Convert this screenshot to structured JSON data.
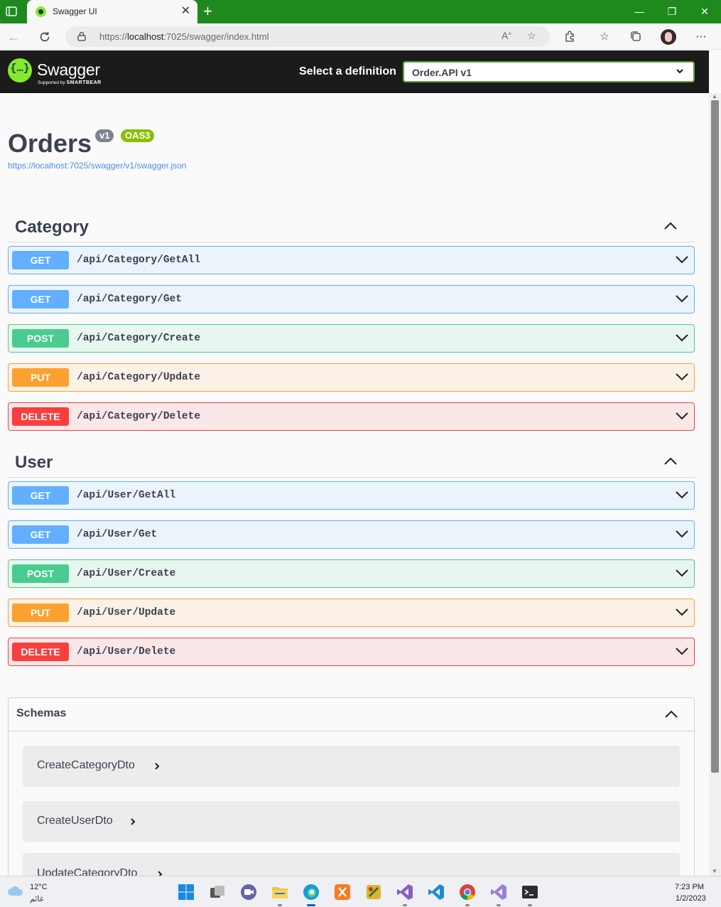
{
  "browser": {
    "tab_title": "Swagger UI",
    "tab_close": "✕",
    "new_tab": "+",
    "url_scheme": "https://",
    "url_host": "localhost",
    "url_rest": ":7025/swagger/index.html",
    "window_controls": [
      "—",
      "❐",
      "✕"
    ]
  },
  "swagger": {
    "logo_text": "Swagger",
    "supported_by": "Supported by",
    "smartbear": "SMARTBEAR",
    "select_label": "Select a definition",
    "definition": "Order.API v1",
    "brand_color": "#85ea2d"
  },
  "info": {
    "title": "Orders",
    "version_badge": "v1",
    "oas_badge": "OAS3",
    "spec_url": "https://localhost:7025/swagger/v1/swagger.json"
  },
  "tags": [
    {
      "name": "Category",
      "operations": [
        {
          "method": "GET",
          "path": "/api/Category/GetAll"
        },
        {
          "method": "GET",
          "path": "/api/Category/Get"
        },
        {
          "method": "POST",
          "path": "/api/Category/Create"
        },
        {
          "method": "PUT",
          "path": "/api/Category/Update"
        },
        {
          "method": "DELETE",
          "path": "/api/Category/Delete"
        }
      ]
    },
    {
      "name": "User",
      "operations": [
        {
          "method": "GET",
          "path": "/api/User/GetAll"
        },
        {
          "method": "GET",
          "path": "/api/User/Get"
        },
        {
          "method": "POST",
          "path": "/api/User/Create"
        },
        {
          "method": "PUT",
          "path": "/api/User/Update"
        },
        {
          "method": "DELETE",
          "path": "/api/User/Delete"
        }
      ]
    }
  ],
  "schemas": {
    "title": "Schemas",
    "items": [
      "CreateCategoryDto",
      "CreateUserDto",
      "UpdateCategoryDto"
    ]
  },
  "method_colors": {
    "GET": "#61affe",
    "POST": "#49cc90",
    "PUT": "#fca130",
    "DELETE": "#f93e3e"
  },
  "taskbar": {
    "temperature": "12°C",
    "condition": "غائم",
    "time": "7:23 PM",
    "date": "1/2/2023",
    "apps": [
      "start-icon",
      "task-view-icon",
      "teams-icon",
      "file-explorer-icon",
      "edge-icon",
      "xampp-icon",
      "tool-icon",
      "visual-studio-icon",
      "vscode-icon",
      "chrome-icon",
      "visual-studio-preview-icon",
      "terminal-icon"
    ]
  }
}
